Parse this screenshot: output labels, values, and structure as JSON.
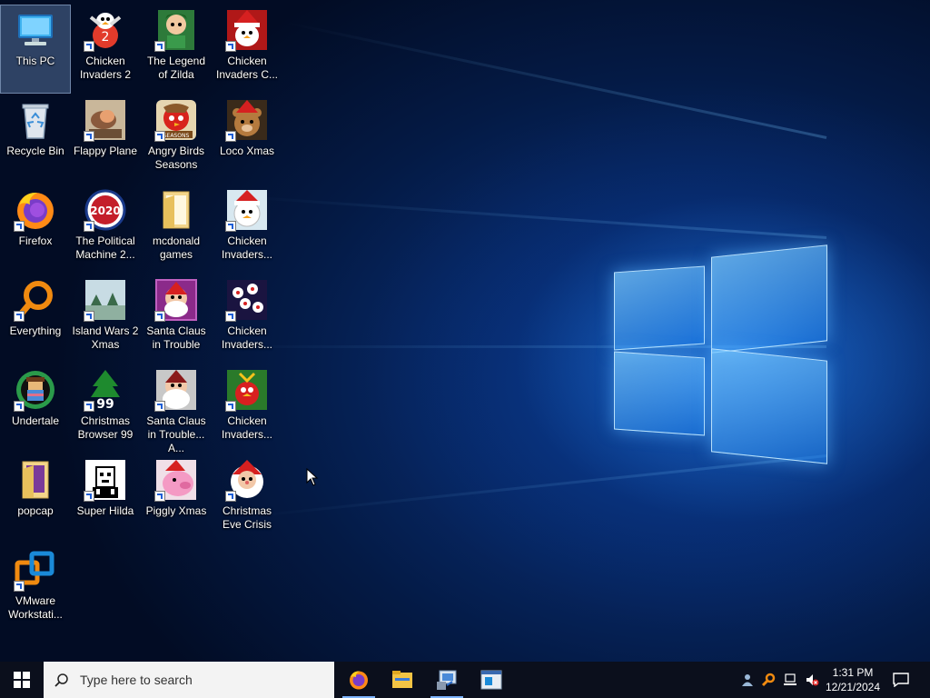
{
  "desktop": {
    "icons": [
      {
        "label": "This PC"
      },
      {
        "label": "Chicken Invaders 2"
      },
      {
        "label": "The Legend of Zilda"
      },
      {
        "label": "Chicken Invaders C..."
      },
      {
        "label": "Recycle Bin"
      },
      {
        "label": "Flappy Plane"
      },
      {
        "label": "Angry Birds Seasons"
      },
      {
        "label": "Loco Xmas"
      },
      {
        "label": "Firefox"
      },
      {
        "label": "The Political Machine 2..."
      },
      {
        "label": "mcdonald games"
      },
      {
        "label": "Chicken Invaders..."
      },
      {
        "label": "Everything"
      },
      {
        "label": "Island Wars 2 Xmas"
      },
      {
        "label": "Santa Claus in Trouble"
      },
      {
        "label": "Chicken Invaders..."
      },
      {
        "label": "Undertale"
      },
      {
        "label": "Christmas Browser 99"
      },
      {
        "label": "Santa Claus in Trouble... A..."
      },
      {
        "label": "Chicken Invaders..."
      },
      {
        "label": "popcap"
      },
      {
        "label": "Super Hilda"
      },
      {
        "label": "Piggly Xmas"
      },
      {
        "label": "Christmas Eve Crisis"
      },
      {
        "label": "VMware Workstati..."
      }
    ],
    "badge_texts": {
      "ci2": "2",
      "pm": "2020",
      "ab": "SEASONS",
      "cb": "99"
    }
  },
  "taskbar": {
    "search_placeholder": "Type here to search",
    "pinned": [
      "firefox-icon",
      "file-explorer-icon",
      "remote-app-icon",
      "vmware-icon"
    ],
    "tray_icons": [
      "people-icon",
      "everything-search-icon",
      "network-icon",
      "volume-muted-icon"
    ],
    "clock": {
      "time": "1:31 PM",
      "date": "12/21/2024"
    },
    "notification_icon": "action-center-icon"
  },
  "colors": {
    "accent": "#1f5fd6",
    "taskbar": "#0b0f1c",
    "search_bg": "#f3f3f3"
  }
}
